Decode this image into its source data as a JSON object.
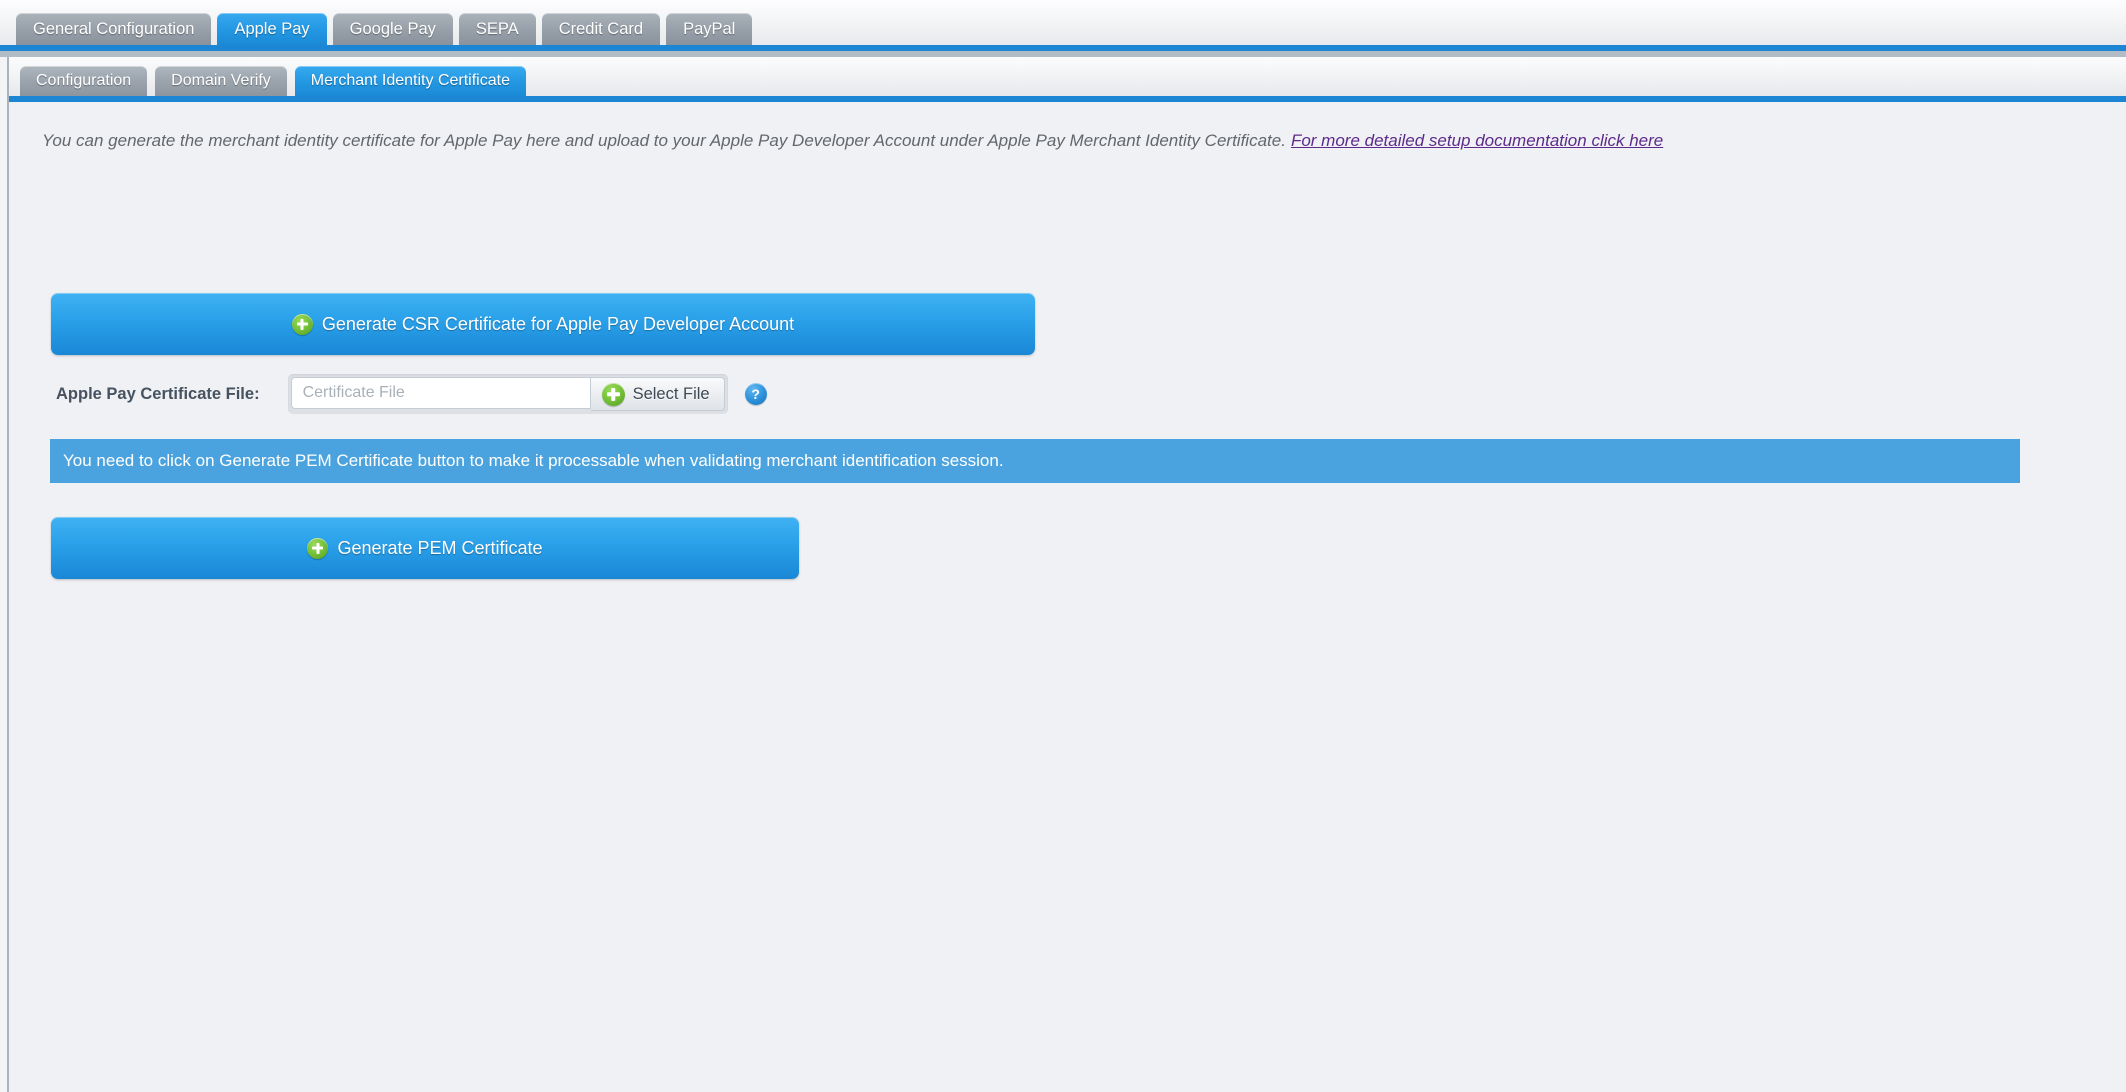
{
  "primary_tabs": [
    {
      "label": "General Configuration",
      "active": false
    },
    {
      "label": "Apple Pay",
      "active": true
    },
    {
      "label": "Google Pay",
      "active": false
    },
    {
      "label": "SEPA",
      "active": false
    },
    {
      "label": "Credit Card",
      "active": false
    },
    {
      "label": "PayPal",
      "active": false
    }
  ],
  "secondary_tabs": [
    {
      "label": "Configuration",
      "active": false
    },
    {
      "label": "Domain Verify",
      "active": false
    },
    {
      "label": "Merchant Identity Certificate",
      "active": true
    }
  ],
  "description": {
    "text": "You can generate the merchant identity certificate for Apple Pay here and upload to your Apple Pay Developer Account under Apple Pay Merchant Identity Certificate.",
    "link_text": "For more detailed setup documentation click here"
  },
  "buttons": {
    "generate_csr": "Generate CSR Certificate for Apple Pay Developer Account",
    "generate_pem": "Generate PEM Certificate",
    "select_file": "Select File"
  },
  "file_field": {
    "label": "Apple Pay Certificate File:",
    "value": "",
    "placeholder": "Certificate File",
    "help_glyph": "?"
  },
  "info_banner": {
    "text": "You need to click on Generate PEM Certificate button to make it processable when validating merchant identification session."
  },
  "colors": {
    "accent_blue": "#1c86d4",
    "button_blue_top": "#3fb2f2",
    "button_blue_bottom": "#1a87d6",
    "banner_blue": "#4aa3de",
    "tab_gray": "#98a1aa",
    "link_purple": "#5d2a8c",
    "plus_green": "#77c23a",
    "page_bg": "#eff1f4"
  }
}
